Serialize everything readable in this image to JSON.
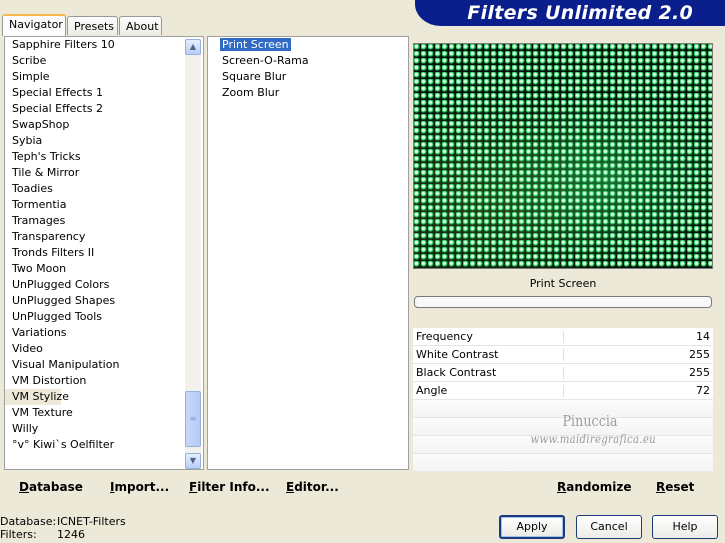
{
  "tabs": [
    {
      "label": "Navigator",
      "active": true
    },
    {
      "label": "Presets",
      "active": false
    },
    {
      "label": "About",
      "active": false
    }
  ],
  "banner": {
    "title": "Filters Unlimited 2.0",
    "color": "#0a1e8c"
  },
  "categories": [
    "Sapphire Filters 10",
    "Scribe",
    "Simple",
    "Special Effects 1",
    "Special Effects 2",
    "SwapShop",
    "Sybia",
    "Teph's Tricks",
    "Tile & Mirror",
    "Toadies",
    "Tormentia",
    "Tramages",
    "Transparency",
    "Tronds Filters II",
    "Two Moon",
    "UnPlugged Colors",
    "UnPlugged Shapes",
    "UnPlugged Tools",
    "Variations",
    "Video",
    "Visual Manipulation",
    "VM Distortion",
    "VM Stylize",
    "VM Texture",
    "Willy",
    "°v° Kiwi`s Oelfilter"
  ],
  "selected_category": "VM Stylize",
  "filters": [
    "Print Screen",
    "Screen-O-Rama",
    "Square Blur",
    "Zoom Blur"
  ],
  "selected_filter": "Print Screen",
  "preview": {
    "filter_name": "Print Screen",
    "progress": 0
  },
  "params": [
    {
      "name": "Frequency",
      "value": "14"
    },
    {
      "name": "White Contrast",
      "value": "255"
    },
    {
      "name": "Black Contrast",
      "value": "255"
    },
    {
      "name": "Angle",
      "value": "72"
    }
  ],
  "watermark": {
    "line1": "Pinuccia",
    "line2": "www.maidiregrafica.eu"
  },
  "toolbar": {
    "database": "Database",
    "import": "Import...",
    "filter_info": "Filter Info...",
    "editor": "Editor...",
    "randomize": "Randomize",
    "reset": "Reset"
  },
  "status": {
    "database_label": "Database:",
    "database_value": "ICNET-Filters",
    "filters_label": "Filters:",
    "filters_value": "1246"
  },
  "buttons": {
    "apply": "Apply",
    "cancel": "Cancel",
    "help": "Help"
  },
  "icons": {
    "scroll_up": "up-arrow-icon",
    "scroll_down": "down-arrow-icon",
    "thumb_grip": "grip-icon"
  }
}
